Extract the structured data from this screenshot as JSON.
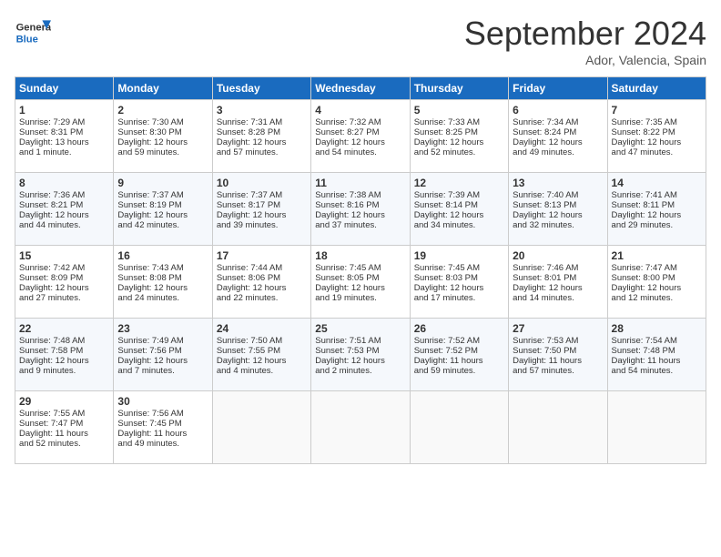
{
  "header": {
    "logo_general": "General",
    "logo_blue": "Blue",
    "month_title": "September 2024",
    "location": "Ador, Valencia, Spain"
  },
  "days_of_week": [
    "Sunday",
    "Monday",
    "Tuesday",
    "Wednesday",
    "Thursday",
    "Friday",
    "Saturday"
  ],
  "weeks": [
    [
      {
        "day": "1",
        "lines": [
          "Sunrise: 7:29 AM",
          "Sunset: 8:31 PM",
          "Daylight: 13 hours",
          "and 1 minute."
        ]
      },
      {
        "day": "2",
        "lines": [
          "Sunrise: 7:30 AM",
          "Sunset: 8:30 PM",
          "Daylight: 12 hours",
          "and 59 minutes."
        ]
      },
      {
        "day": "3",
        "lines": [
          "Sunrise: 7:31 AM",
          "Sunset: 8:28 PM",
          "Daylight: 12 hours",
          "and 57 minutes."
        ]
      },
      {
        "day": "4",
        "lines": [
          "Sunrise: 7:32 AM",
          "Sunset: 8:27 PM",
          "Daylight: 12 hours",
          "and 54 minutes."
        ]
      },
      {
        "day": "5",
        "lines": [
          "Sunrise: 7:33 AM",
          "Sunset: 8:25 PM",
          "Daylight: 12 hours",
          "and 52 minutes."
        ]
      },
      {
        "day": "6",
        "lines": [
          "Sunrise: 7:34 AM",
          "Sunset: 8:24 PM",
          "Daylight: 12 hours",
          "and 49 minutes."
        ]
      },
      {
        "day": "7",
        "lines": [
          "Sunrise: 7:35 AM",
          "Sunset: 8:22 PM",
          "Daylight: 12 hours",
          "and 47 minutes."
        ]
      }
    ],
    [
      {
        "day": "8",
        "lines": [
          "Sunrise: 7:36 AM",
          "Sunset: 8:21 PM",
          "Daylight: 12 hours",
          "and 44 minutes."
        ]
      },
      {
        "day": "9",
        "lines": [
          "Sunrise: 7:37 AM",
          "Sunset: 8:19 PM",
          "Daylight: 12 hours",
          "and 42 minutes."
        ]
      },
      {
        "day": "10",
        "lines": [
          "Sunrise: 7:37 AM",
          "Sunset: 8:17 PM",
          "Daylight: 12 hours",
          "and 39 minutes."
        ]
      },
      {
        "day": "11",
        "lines": [
          "Sunrise: 7:38 AM",
          "Sunset: 8:16 PM",
          "Daylight: 12 hours",
          "and 37 minutes."
        ]
      },
      {
        "day": "12",
        "lines": [
          "Sunrise: 7:39 AM",
          "Sunset: 8:14 PM",
          "Daylight: 12 hours",
          "and 34 minutes."
        ]
      },
      {
        "day": "13",
        "lines": [
          "Sunrise: 7:40 AM",
          "Sunset: 8:13 PM",
          "Daylight: 12 hours",
          "and 32 minutes."
        ]
      },
      {
        "day": "14",
        "lines": [
          "Sunrise: 7:41 AM",
          "Sunset: 8:11 PM",
          "Daylight: 12 hours",
          "and 29 minutes."
        ]
      }
    ],
    [
      {
        "day": "15",
        "lines": [
          "Sunrise: 7:42 AM",
          "Sunset: 8:09 PM",
          "Daylight: 12 hours",
          "and 27 minutes."
        ]
      },
      {
        "day": "16",
        "lines": [
          "Sunrise: 7:43 AM",
          "Sunset: 8:08 PM",
          "Daylight: 12 hours",
          "and 24 minutes."
        ]
      },
      {
        "day": "17",
        "lines": [
          "Sunrise: 7:44 AM",
          "Sunset: 8:06 PM",
          "Daylight: 12 hours",
          "and 22 minutes."
        ]
      },
      {
        "day": "18",
        "lines": [
          "Sunrise: 7:45 AM",
          "Sunset: 8:05 PM",
          "Daylight: 12 hours",
          "and 19 minutes."
        ]
      },
      {
        "day": "19",
        "lines": [
          "Sunrise: 7:45 AM",
          "Sunset: 8:03 PM",
          "Daylight: 12 hours",
          "and 17 minutes."
        ]
      },
      {
        "day": "20",
        "lines": [
          "Sunrise: 7:46 AM",
          "Sunset: 8:01 PM",
          "Daylight: 12 hours",
          "and 14 minutes."
        ]
      },
      {
        "day": "21",
        "lines": [
          "Sunrise: 7:47 AM",
          "Sunset: 8:00 PM",
          "Daylight: 12 hours",
          "and 12 minutes."
        ]
      }
    ],
    [
      {
        "day": "22",
        "lines": [
          "Sunrise: 7:48 AM",
          "Sunset: 7:58 PM",
          "Daylight: 12 hours",
          "and 9 minutes."
        ]
      },
      {
        "day": "23",
        "lines": [
          "Sunrise: 7:49 AM",
          "Sunset: 7:56 PM",
          "Daylight: 12 hours",
          "and 7 minutes."
        ]
      },
      {
        "day": "24",
        "lines": [
          "Sunrise: 7:50 AM",
          "Sunset: 7:55 PM",
          "Daylight: 12 hours",
          "and 4 minutes."
        ]
      },
      {
        "day": "25",
        "lines": [
          "Sunrise: 7:51 AM",
          "Sunset: 7:53 PM",
          "Daylight: 12 hours",
          "and 2 minutes."
        ]
      },
      {
        "day": "26",
        "lines": [
          "Sunrise: 7:52 AM",
          "Sunset: 7:52 PM",
          "Daylight: 11 hours",
          "and 59 minutes."
        ]
      },
      {
        "day": "27",
        "lines": [
          "Sunrise: 7:53 AM",
          "Sunset: 7:50 PM",
          "Daylight: 11 hours",
          "and 57 minutes."
        ]
      },
      {
        "day": "28",
        "lines": [
          "Sunrise: 7:54 AM",
          "Sunset: 7:48 PM",
          "Daylight: 11 hours",
          "and 54 minutes."
        ]
      }
    ],
    [
      {
        "day": "29",
        "lines": [
          "Sunrise: 7:55 AM",
          "Sunset: 7:47 PM",
          "Daylight: 11 hours",
          "and 52 minutes."
        ]
      },
      {
        "day": "30",
        "lines": [
          "Sunrise: 7:56 AM",
          "Sunset: 7:45 PM",
          "Daylight: 11 hours",
          "and 49 minutes."
        ]
      },
      {
        "day": "",
        "lines": []
      },
      {
        "day": "",
        "lines": []
      },
      {
        "day": "",
        "lines": []
      },
      {
        "day": "",
        "lines": []
      },
      {
        "day": "",
        "lines": []
      }
    ]
  ]
}
